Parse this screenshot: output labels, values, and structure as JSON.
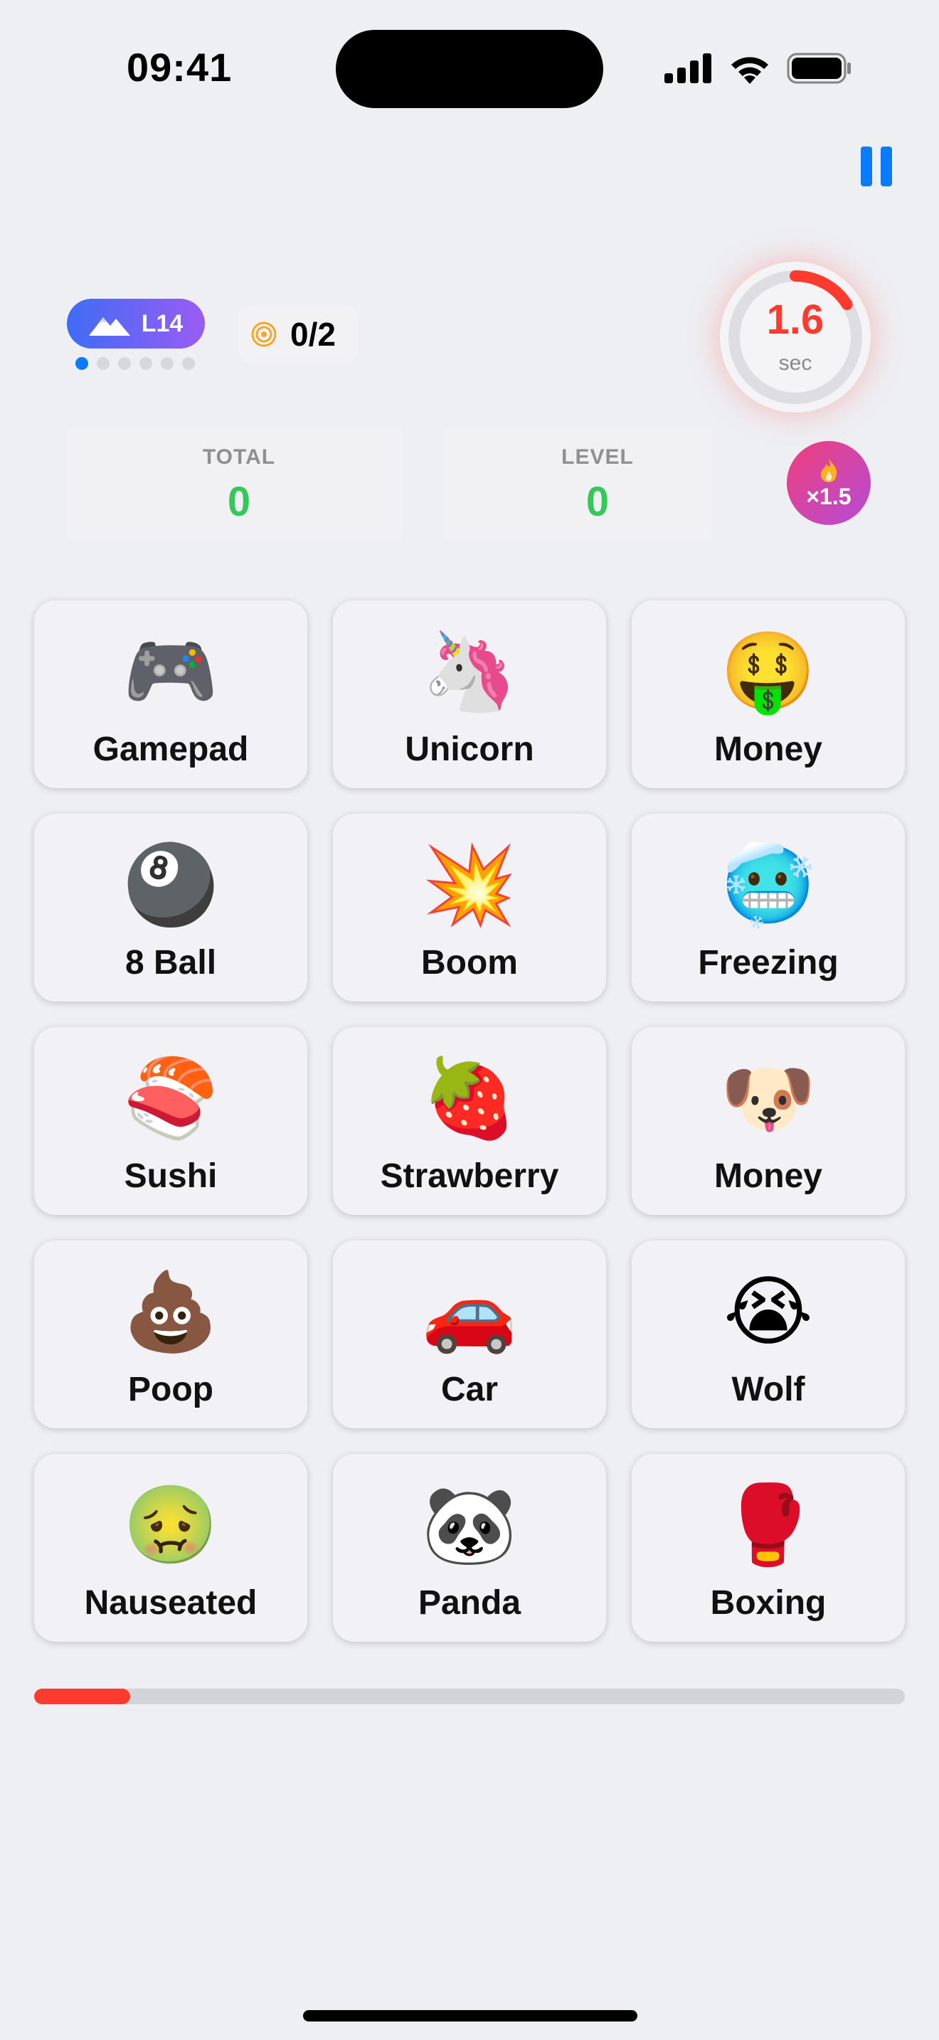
{
  "status_bar": {
    "time": "09:41"
  },
  "header": {
    "level_label": "L14",
    "level_dots_total": 6,
    "level_dots_active": 0,
    "target_progress": "0/2"
  },
  "timer": {
    "value": "1.6",
    "unit": "sec",
    "fraction_remaining": 0.16,
    "color": "#ff3b30"
  },
  "stats": {
    "total_label": "TOTAL",
    "total_value": "0",
    "level_label": "LEVEL",
    "level_value": "0",
    "multiplier": "×1.5"
  },
  "cards": [
    {
      "emoji": "🎮",
      "label": "Gamepad"
    },
    {
      "emoji": "🦄",
      "label": "Unicorn"
    },
    {
      "emoji": "🤑",
      "label": "Money"
    },
    {
      "emoji": "🎱",
      "label": "8 Ball"
    },
    {
      "emoji": "💥",
      "label": "Boom"
    },
    {
      "emoji": "🥶",
      "label": "Freezing"
    },
    {
      "emoji": "🍣",
      "label": "Sushi"
    },
    {
      "emoji": "🍓",
      "label": "Strawberry"
    },
    {
      "emoji": "🐶",
      "label": "Money"
    },
    {
      "emoji": "💩",
      "label": "Poop"
    },
    {
      "emoji": "🚗",
      "label": "Car"
    },
    {
      "emoji": "😭",
      "label": "Wolf"
    },
    {
      "emoji": "🤢",
      "label": "Nauseated"
    },
    {
      "emoji": "🐼",
      "label": "Panda"
    },
    {
      "emoji": "🥊",
      "label": "Boxing"
    }
  ],
  "progress": {
    "fraction": 0.11,
    "color": "#ff3b30"
  },
  "colors": {
    "accent": "#0a7bff",
    "score": "#34c759",
    "danger": "#ff3b30"
  },
  "icons": {
    "pause": "pause-icon",
    "level": "mountain-icon",
    "target": "target-icon",
    "multiplier": "flame-icon"
  }
}
